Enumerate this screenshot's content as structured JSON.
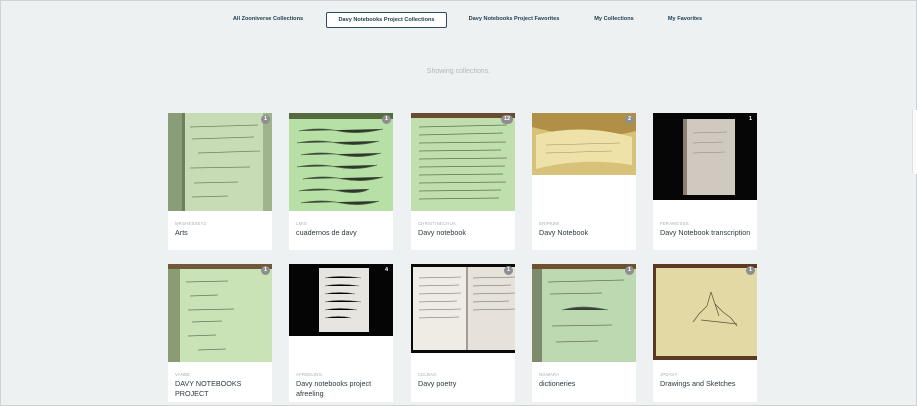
{
  "tabs": [
    {
      "label": "All Zooniverse Collections",
      "active": false
    },
    {
      "label": "Davy Notebooks Project Collections",
      "active": true
    },
    {
      "label": "Davy Notebooks Project Favorites",
      "active": false
    },
    {
      "label": "My Collections",
      "active": false
    },
    {
      "label": "My Favorites",
      "active": false
    }
  ],
  "status_text": "Showing collections.",
  "collections": [
    {
      "owner": "MRSHESSEY2",
      "title": "Arts",
      "count": "1",
      "thumb": "green"
    },
    {
      "owner": "LMIS",
      "title": "cuadernos de davy",
      "count": "1",
      "thumb": "green"
    },
    {
      "owner": "CHRISTINECHUA",
      "title": "Davy notebook",
      "count": "12",
      "thumb": "green"
    },
    {
      "owner": "ERIPKIMI",
      "title": "Davy Notebook",
      "count": "2",
      "thumb": "yellow"
    },
    {
      "owner": "FERAMOSSS",
      "title": "Davy Notebook transcription",
      "count": "1",
      "thumb": "dark"
    },
    {
      "owner": "VANBE",
      "title": "DAVY NOTEBOOKS PROJECT",
      "count": "1",
      "thumb": "green"
    },
    {
      "owner": "AFREELING",
      "title": "Davy notebooks project afreeling",
      "count": "4",
      "thumb": "darkpage"
    },
    {
      "owner": "CELBAO",
      "title": "Davy poetry",
      "count": "1",
      "thumb": "openbook"
    },
    {
      "owner": "NGWARA",
      "title": "dictioneries",
      "count": "1",
      "thumb": "green"
    },
    {
      "owner": "JPDAVY",
      "title": "Drawings and Sketches",
      "count": "1",
      "thumb": "sketch"
    }
  ]
}
